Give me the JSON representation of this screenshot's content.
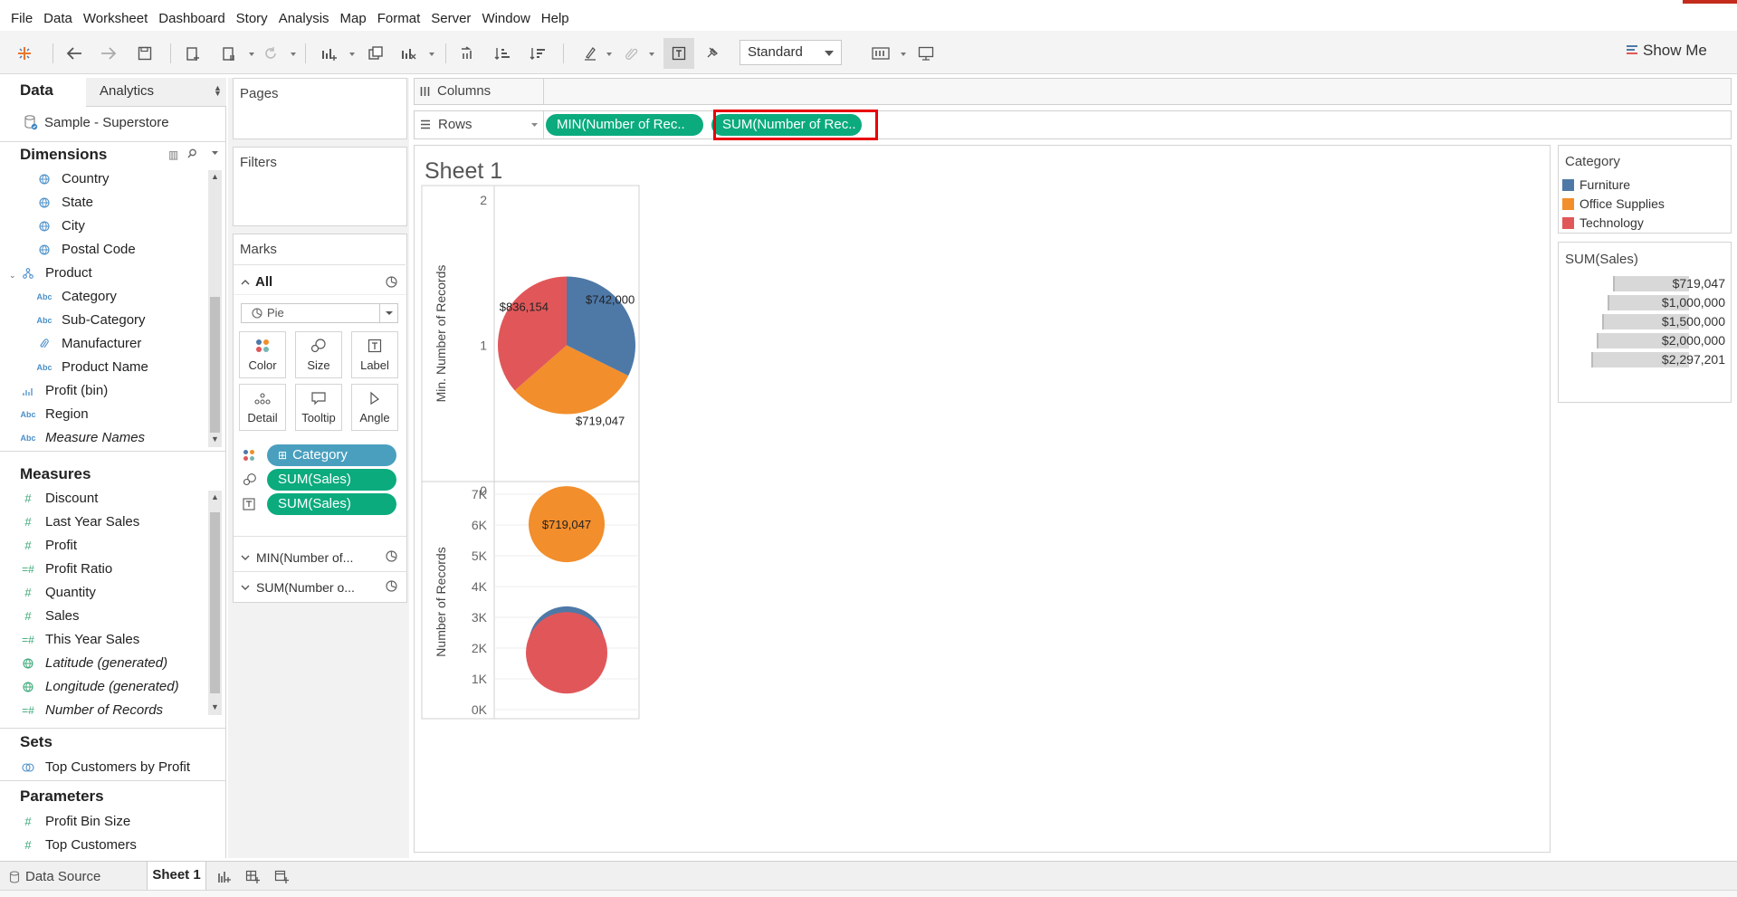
{
  "menu": [
    "File",
    "Data",
    "Worksheet",
    "Dashboard",
    "Story",
    "Analysis",
    "Map",
    "Format",
    "Server",
    "Window",
    "Help"
  ],
  "toolbar": {
    "fit_select": "Standard",
    "show_me": "Show Me"
  },
  "left_panel": {
    "tab_data": "Data",
    "tab_analytics": "Analytics",
    "datasource": "Sample - Superstore",
    "dimensions_title": "Dimensions",
    "dimensions": [
      {
        "label": "Country",
        "icon": "globe-icon"
      },
      {
        "label": "State",
        "icon": "globe-icon"
      },
      {
        "label": "City",
        "icon": "globe-icon"
      },
      {
        "label": "Postal Code",
        "icon": "globe-icon"
      },
      {
        "label": "Product",
        "icon": "hierarchy-icon"
      },
      {
        "label": "Category",
        "icon": "abc-icon"
      },
      {
        "label": "Sub-Category",
        "icon": "abc-icon"
      },
      {
        "label": "Manufacturer",
        "icon": "paperclip-icon"
      },
      {
        "label": "Product Name",
        "icon": "abc-icon"
      },
      {
        "label": "Profit (bin)",
        "icon": "bin-icon"
      },
      {
        "label": "Region",
        "icon": "abc-icon"
      },
      {
        "label": "Measure Names",
        "icon": "abc-icon"
      }
    ],
    "measures_title": "Measures",
    "measures": [
      {
        "label": "Discount"
      },
      {
        "label": "Last Year Sales"
      },
      {
        "label": "Profit"
      },
      {
        "label": "Profit Ratio"
      },
      {
        "label": "Quantity"
      },
      {
        "label": "Sales"
      },
      {
        "label": "This Year Sales"
      },
      {
        "label": "Latitude (generated)"
      },
      {
        "label": "Longitude (generated)"
      },
      {
        "label": "Number of Records"
      }
    ],
    "sets_title": "Sets",
    "sets": [
      {
        "label": "Top Customers by Profit"
      }
    ],
    "parameters_title": "Parameters",
    "parameters": [
      {
        "label": "Profit Bin Size"
      },
      {
        "label": "Top Customers"
      }
    ]
  },
  "pages_title": "Pages",
  "filters_title": "Filters",
  "marks": {
    "title": "Marks",
    "all_label": "All",
    "mark_type": "Pie",
    "buttons": [
      "Color",
      "Size",
      "Label",
      "Detail",
      "Tooltip",
      "Angle"
    ],
    "pills": [
      "Category",
      "SUM(Sales)",
      "SUM(Sales)"
    ],
    "sub1": "MIN(Number of...",
    "sub2": "SUM(Number o..."
  },
  "shelves": {
    "columns_label": "Columns",
    "rows_label": "Rows",
    "rows_pills": [
      "MIN(Number of Rec..",
      "SUM(Number of Rec.."
    ]
  },
  "sheet_title": "Sheet 1",
  "colors": {
    "furniture": "#4e79a7",
    "office": "#f28e2b",
    "technology": "#e15759",
    "pill_green": "#0bab7e",
    "highlight": "#e8000b"
  },
  "chart_data": [
    {
      "type": "pie",
      "ylabel": "Min. Number of Records",
      "yticks": [
        "2",
        "1",
        "0"
      ],
      "ylim": [
        0,
        2
      ],
      "y": 1,
      "slices": [
        {
          "category": "Furniture",
          "value": 742000,
          "label": "$742,000"
        },
        {
          "category": "Office Supplies",
          "value": 719047,
          "label": "$719,047"
        },
        {
          "category": "Technology",
          "value": 836154,
          "label": "$836,154"
        }
      ]
    },
    {
      "type": "scatter",
      "ylabel": "Number of Records",
      "yticks": [
        "7K",
        "6K",
        "5K",
        "4K",
        "3K",
        "2K",
        "1K",
        "0K"
      ],
      "ylim": [
        0,
        7000
      ],
      "points": [
        {
          "category": "Office Supplies",
          "y": 6026,
          "label": "$719,047"
        },
        {
          "category": "Furniture",
          "y": 2121,
          "label": ""
        },
        {
          "category": "Technology",
          "y": 1847,
          "label": ""
        }
      ]
    }
  ],
  "legend": {
    "title": "Category",
    "items": [
      "Furniture",
      "Office Supplies",
      "Technology"
    ],
    "size_title": "SUM(Sales)",
    "size_items": [
      "$719,047",
      "$1,000,000",
      "$1,500,000",
      "$2,000,000",
      "$2,297,201"
    ]
  },
  "bottom": {
    "datasource_tab": "Data Source",
    "sheet_tab": "Sheet 1"
  }
}
